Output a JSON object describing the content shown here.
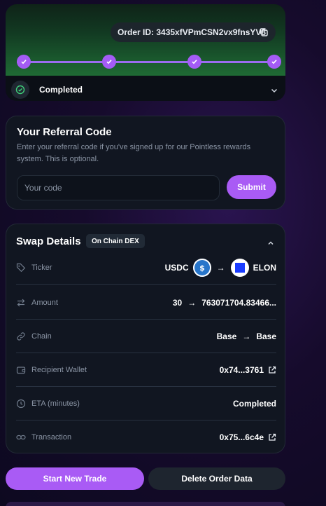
{
  "order": {
    "label": "Order ID: 3435xfVPmCSN2vx9fnsYV8",
    "icon": "copy-icon"
  },
  "progress": {
    "steps_completed": 4,
    "steps_total": 4,
    "status": "Completed"
  },
  "referral": {
    "title": "Your Referral Code",
    "description": "Enter your referral code if you've signed up for our Pointless rewards system. This is optional.",
    "placeholder": "Your code",
    "submit_label": "Submit"
  },
  "swap": {
    "title": "Swap Details",
    "badge": "On Chain DEX",
    "rows": {
      "ticker": {
        "label": "Ticker",
        "from": "USDC",
        "to": "ELON"
      },
      "amount": {
        "label": "Amount",
        "from": "30",
        "to": "763071704.83466..."
      },
      "chain": {
        "label": "Chain",
        "from": "Base",
        "to": "Base"
      },
      "recipient": {
        "label": "Recipient Wallet",
        "value": "0x74...3761"
      },
      "eta": {
        "label": "ETA (minutes)",
        "value": "Completed"
      },
      "transaction": {
        "label": "Transaction",
        "value": "0x75...6c4e"
      }
    },
    "arrow": "→"
  },
  "actions": {
    "start_label": "Start New Trade",
    "delete_label": "Delete Order Data"
  },
  "colors": {
    "accent": "#a95bf5",
    "progress_green": "#1f6b34",
    "card_bg": "#111621",
    "usdc_blue": "#2775ca",
    "elon_blue": "#1a3cff"
  }
}
